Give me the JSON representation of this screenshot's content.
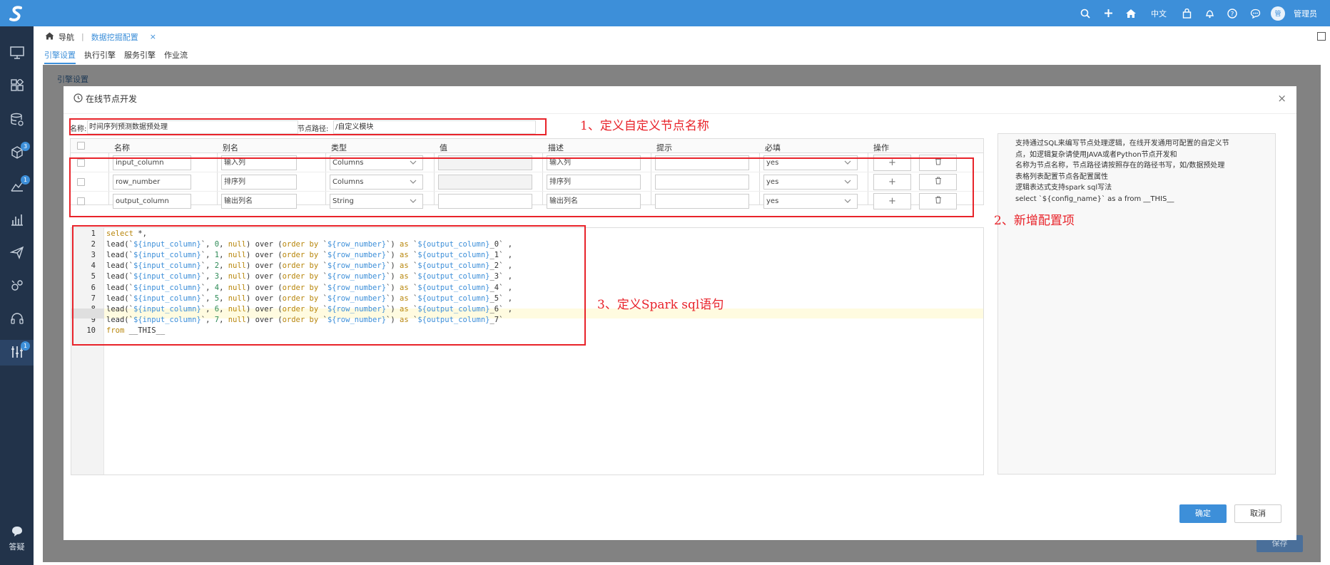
{
  "topbar": {
    "lang": "中文",
    "avatar": "管",
    "user": "管理员"
  },
  "sidebar": {
    "badges": [
      "3",
      "1",
      "1"
    ],
    "help_label": "答疑"
  },
  "breadcrumb": {
    "home": "导航",
    "sep": "|",
    "tab": "数据挖掘配置",
    "close": "×"
  },
  "tabs": [
    "引擎设置",
    "执行引擎",
    "服务引擎",
    "作业流"
  ],
  "background_label": "引擎设置",
  "save_label": "保存",
  "dialog": {
    "title": "在线节点开发",
    "close": "×",
    "name_label": "名称:",
    "name_value": "时间序列预测数据预处理",
    "path_label": "节点路径:",
    "path_value": "/自定义模块",
    "columns": [
      "名称",
      "别名",
      "类型",
      "值",
      "描述",
      "提示",
      "必填",
      "操作"
    ],
    "rows": [
      {
        "name": "input_column",
        "alias": "输入列",
        "type": "Columns",
        "value": "",
        "desc": "输入列",
        "hint": "",
        "required": "yes",
        "value_disabled": true
      },
      {
        "name": "row_number",
        "alias": "排序列",
        "type": "Columns",
        "value": "",
        "desc": "排序列",
        "hint": "",
        "required": "yes",
        "value_disabled": true
      },
      {
        "name": "output_column",
        "alias": "输出列名",
        "type": "String",
        "value": "",
        "desc": "输出列名",
        "hint": "",
        "required": "yes",
        "value_disabled": false
      }
    ],
    "add_symbol": "+",
    "delete_symbol": "🗑",
    "code_lines": [
      "select *,",
      "lead(`${input_column}`, 0, null) over (order by `${row_number}`) as `${output_column}_0` ,",
      "lead(`${input_column}`, 1, null) over (order by `${row_number}`) as `${output_column}_1` ,",
      "lead(`${input_column}`, 2, null) over (order by `${row_number}`) as `${output_column}_2` ,",
      "lead(`${input_column}`, 3, null) over (order by `${row_number}`) as `${output_column}_3` ,",
      "lead(`${input_column}`, 4, null) over (order by `${row_number}`) as `${output_column}_4` ,",
      "lead(`${input_column}`, 5, null) over (order by `${row_number}`) as `${output_column}_5` ,",
      "lead(`${input_column}`, 6, null) over (order by `${row_number}`) as `${output_column}_6` ,",
      "lead(`${input_column}`, 7, null) over (order by `${row_number}`) as `${output_column}_7`",
      "from __THIS__"
    ],
    "hint_lines": [
      "支持通过SQL来编写节点处理逻辑，在线开发通用可配置的自定义节",
      "点，如逻辑复杂请使用JAVA或者Python节点开发和",
      "名称为节点名称，节点路径请按照存在的路径书写，如/数据预处理",
      "表格列表配置节点各配置属性",
      "逻辑表达式支持spark sql写法",
      "select `${config_name}` as a from __THIS__"
    ],
    "ok_label": "确定",
    "cancel_label": "取消"
  },
  "annotations": [
    "1、定义自定义节点名称",
    "2、新增配置项",
    "3、定义Spark sql语句"
  ],
  "colors": {
    "accent": "#3d8fd9",
    "sidebar": "#22334a",
    "annotation": "#e8232a"
  }
}
